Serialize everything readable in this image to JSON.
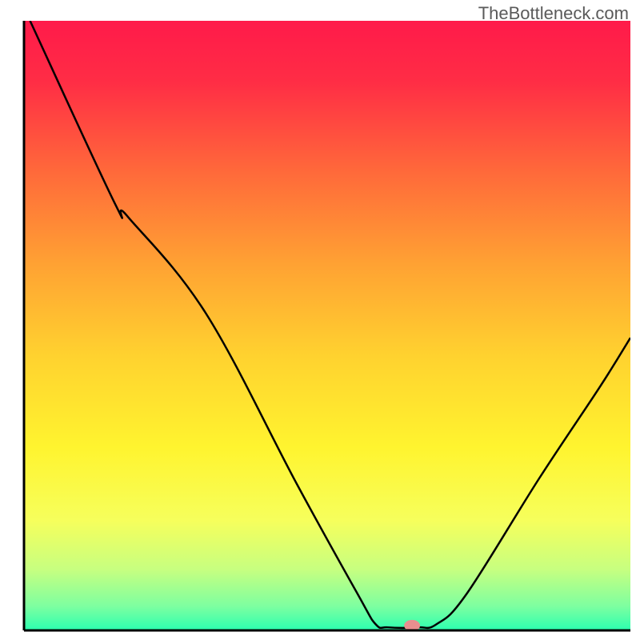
{
  "watermark": "TheBottleneck.com",
  "chart_data": {
    "type": "line",
    "title": "",
    "xlabel": "",
    "ylabel": "",
    "xlim": [
      0,
      100
    ],
    "ylim": [
      0,
      100
    ],
    "axes": {
      "color": "#000000",
      "width": 3
    },
    "background_gradient": {
      "stops": [
        {
          "pos": 0.0,
          "color": "#ff1a4a"
        },
        {
          "pos": 0.1,
          "color": "#ff2d45"
        },
        {
          "pos": 0.25,
          "color": "#ff6a3a"
        },
        {
          "pos": 0.4,
          "color": "#ffa233"
        },
        {
          "pos": 0.55,
          "color": "#ffd22f"
        },
        {
          "pos": 0.7,
          "color": "#fff42f"
        },
        {
          "pos": 0.82,
          "color": "#f6ff5c"
        },
        {
          "pos": 0.9,
          "color": "#c7ff80"
        },
        {
          "pos": 0.96,
          "color": "#7effa0"
        },
        {
          "pos": 1.0,
          "color": "#2bffb0"
        }
      ]
    },
    "series": [
      {
        "name": "bottleneck-curve",
        "color": "#000000",
        "width": 2.5,
        "points": [
          {
            "x": 1,
            "y": 100
          },
          {
            "x": 15,
            "y": 70
          },
          {
            "x": 17,
            "y": 68
          },
          {
            "x": 30,
            "y": 52
          },
          {
            "x": 45,
            "y": 24
          },
          {
            "x": 55,
            "y": 6
          },
          {
            "x": 58,
            "y": 1
          },
          {
            "x": 60,
            "y": 0.5
          },
          {
            "x": 65,
            "y": 0.5
          },
          {
            "x": 68,
            "y": 1
          },
          {
            "x": 73,
            "y": 6
          },
          {
            "x": 85,
            "y": 25
          },
          {
            "x": 95,
            "y": 40
          },
          {
            "x": 100,
            "y": 48
          }
        ]
      }
    ],
    "marker": {
      "name": "optimal-point",
      "x": 64,
      "y": 0.8,
      "color": "#e88f8f",
      "rx": 10,
      "ry": 7
    }
  }
}
